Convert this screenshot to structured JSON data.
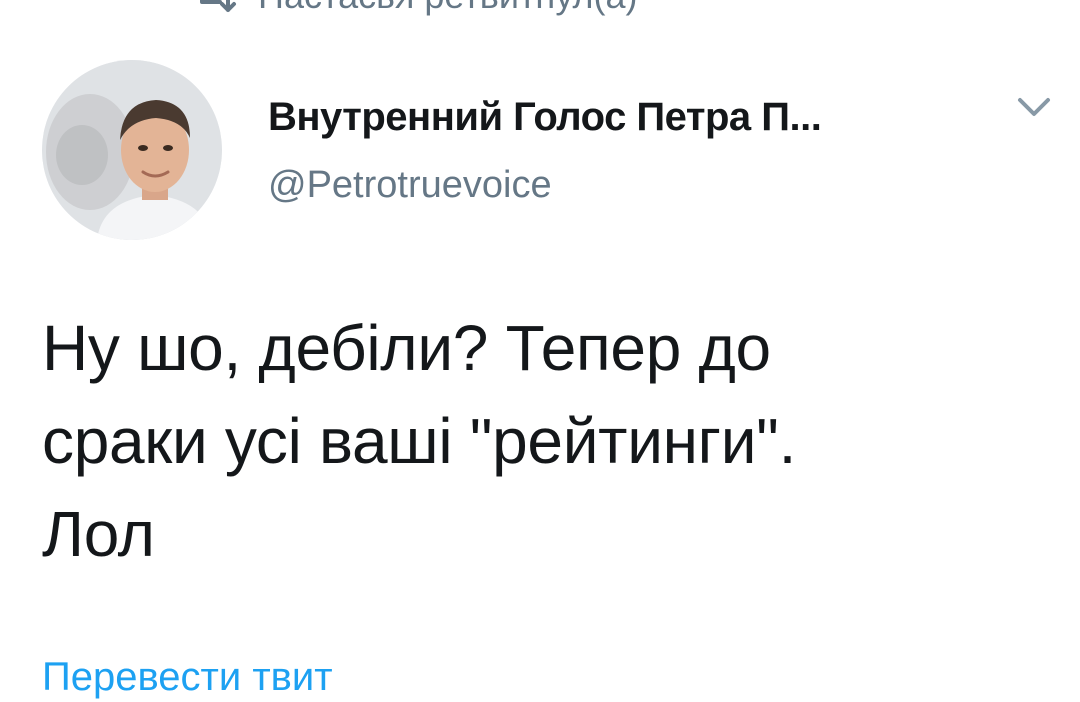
{
  "retweet": {
    "icon": "retweet-icon",
    "text": "Настасья ретвитнул(а)"
  },
  "author": {
    "display_name": "Внутренний Голос Петра П...",
    "handle": "@Petrotruevoice",
    "avatar_icon": "avatar"
  },
  "menu": {
    "icon": "chevron-down-icon"
  },
  "tweet": {
    "text": "Ну шо, дебіли? Тепер до\nсраки усі ваші \"рейтинги\".\nЛол"
  },
  "translate": {
    "label": "Перевести твит"
  },
  "colors": {
    "text_primary": "#14171a",
    "text_secondary": "#657786",
    "link": "#1da1f2"
  }
}
